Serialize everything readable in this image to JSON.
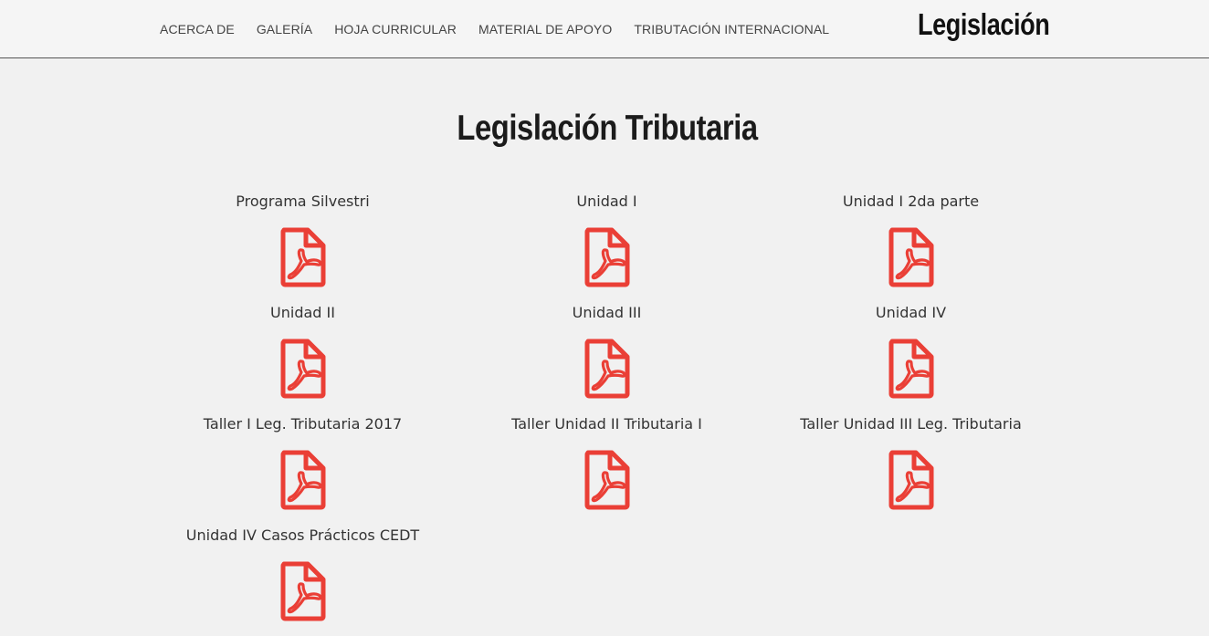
{
  "nav": {
    "items": [
      {
        "label": "ACERCA DE"
      },
      {
        "label": "GALERÍA"
      },
      {
        "label": "HOJA CURRICULAR"
      },
      {
        "label": "MATERIAL DE APOYO"
      },
      {
        "label": "TRIBUTACIÓN INTERNACIONAL"
      }
    ],
    "brand": "Legislación"
  },
  "page": {
    "title": "Legislación Tributaria"
  },
  "documents": [
    {
      "title": "Programa Silvestri",
      "icon": "pdf-file-icon"
    },
    {
      "title": "Unidad I",
      "icon": "pdf-file-icon"
    },
    {
      "title": "Unidad I 2da parte",
      "icon": "pdf-file-icon"
    },
    {
      "title": "Unidad II",
      "icon": "pdf-file-icon"
    },
    {
      "title": "Unidad III",
      "icon": "pdf-file-icon"
    },
    {
      "title": "Unidad IV",
      "icon": "pdf-file-icon"
    },
    {
      "title": "Taller I Leg. Tributaria 2017",
      "icon": "pdf-file-icon"
    },
    {
      "title": "Taller Unidad II Tributaria I",
      "icon": "pdf-file-icon"
    },
    {
      "title": "Taller Unidad III Leg. Tributaria",
      "icon": "pdf-file-icon"
    },
    {
      "title": "Unidad IV Casos Prácticos CEDT",
      "icon": "pdf-file-icon"
    }
  ],
  "colors": {
    "pdf_icon": "#ea3f36",
    "background": "#f1f1f1",
    "header_bg": "#f5f5f5"
  }
}
